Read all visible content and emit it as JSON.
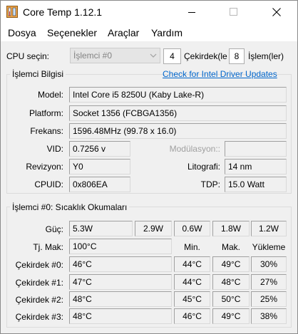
{
  "window": {
    "title": "Core Temp 1.12.1"
  },
  "menu": [
    "Dosya",
    "Seçenekler",
    "Araçlar",
    "Yardım"
  ],
  "cpu_select": {
    "label": "CPU seçin:",
    "selected": "İşlemci #0",
    "cores_value": "4",
    "cores_label": "Çekirdek(le",
    "threads_value": "8",
    "threads_label": "İşlem(ler)"
  },
  "processor_info": {
    "group_title": "İşlemci Bilgisi",
    "link": "Check for Intel Driver Updates",
    "model_label": "Model:",
    "model_value": "Intel Core i5 8250U (Kaby Lake-R)",
    "platform_label": "Platform:",
    "platform_value": "Socket 1356 (FCBGA1356)",
    "frequency_label": "Frekans:",
    "frequency_value": "1596.48MHz (99.78 x 16.0)",
    "vid_label": "VID:",
    "vid_value": "0.7256 v",
    "modulation_label": "Modülasyon::",
    "modulation_value": "",
    "revision_label": "Revizyon:",
    "revision_value": "Y0",
    "lithography_label": "Litografi:",
    "lithography_value": "14 nm",
    "cpuid_label": "CPUID:",
    "cpuid_value": "0x806EA",
    "tdp_label": "TDP:",
    "tdp_value": "15.0 Watt"
  },
  "temps": {
    "group_title": "İşlemci #0: Sıcaklık Okumaları",
    "power_label": "Güç:",
    "power_values": [
      "5.3W",
      "2.9W",
      "0.6W",
      "1.8W",
      "1.2W"
    ],
    "tjmax_label": "Tj. Mak:",
    "tjmax_value": "100°C",
    "col_min": "Min.",
    "col_max": "Mak.",
    "col_load": "Yükleme",
    "cores": [
      {
        "label": "Çekirdek #0:",
        "temp": "46°C",
        "min": "44°C",
        "max": "49°C",
        "load": "30%"
      },
      {
        "label": "Çekirdek #1:",
        "temp": "47°C",
        "min": "44°C",
        "max": "48°C",
        "load": "27%"
      },
      {
        "label": "Çekirdek #2:",
        "temp": "48°C",
        "min": "45°C",
        "max": "50°C",
        "load": "25%"
      },
      {
        "label": "Çekirdek #3:",
        "temp": "48°C",
        "min": "46°C",
        "max": "49°C",
        "load": "38%"
      }
    ]
  }
}
